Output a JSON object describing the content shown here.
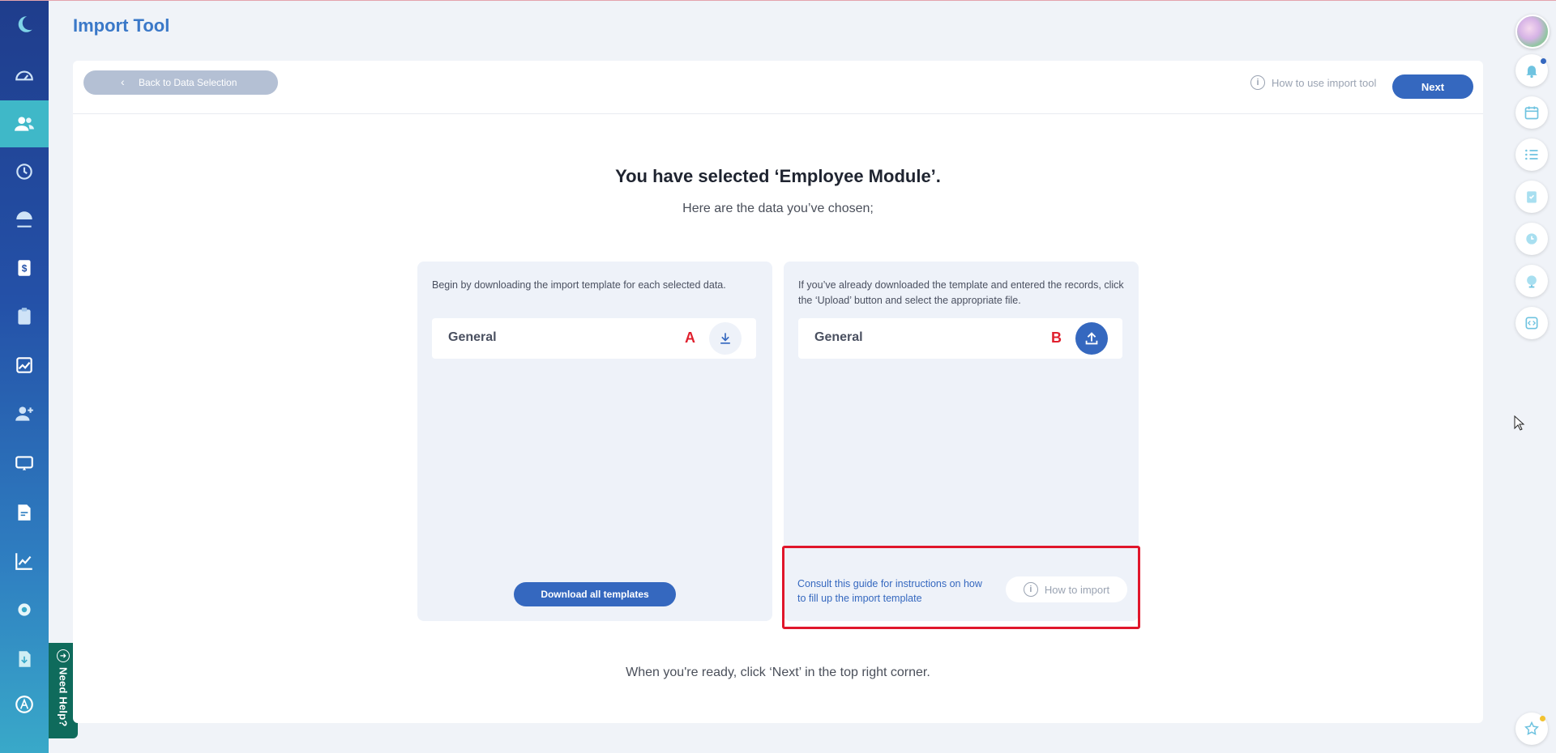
{
  "sidebar": {
    "items": [
      {
        "icon": "moon-logo-icon",
        "active": false
      },
      {
        "icon": "dashboard-gauge-icon",
        "active": false
      },
      {
        "icon": "employees-icon",
        "active": true
      },
      {
        "icon": "history-clock-icon",
        "active": false
      },
      {
        "icon": "leave-umbrella-icon",
        "active": false
      },
      {
        "icon": "payroll-dollar-icon",
        "active": false
      },
      {
        "icon": "clipboard-icon",
        "active": false
      },
      {
        "icon": "image-chart-icon",
        "active": false
      },
      {
        "icon": "add-user-icon",
        "active": false
      },
      {
        "icon": "training-screen-icon",
        "active": false
      },
      {
        "icon": "document-icon",
        "active": false
      },
      {
        "icon": "analytics-line-icon",
        "active": false
      },
      {
        "icon": "settings-gear-icon",
        "active": false
      },
      {
        "icon": "file-download-icon",
        "active": false
      },
      {
        "icon": "app-store-icon",
        "active": false
      }
    ],
    "need_help_label": "Need Help?"
  },
  "header": {
    "title": "Import Tool"
  },
  "toolbar": {
    "back_label": "Back to Data Selection",
    "how_to_use_label": "How to use import tool",
    "next_label": "Next"
  },
  "main": {
    "heading": "You have selected ‘Employee Module’.",
    "subheading": "Here are the data you’ve chosen;",
    "download_panel": {
      "instruction": "Begin by downloading the import template for each selected data.",
      "items": [
        {
          "name": "General",
          "marker": "A"
        }
      ],
      "download_all_label": "Download all templates"
    },
    "upload_panel": {
      "instruction": "If you’ve already downloaded the template and entered the records, click the ‘Upload’ button and select the appropriate file.",
      "items": [
        {
          "name": "General",
          "marker": "B"
        }
      ],
      "guide_text": "Consult this guide for instructions on how to fill up the import template",
      "how_to_import_label": "How to import"
    },
    "footer": "When you're ready, click ‘Next’ in the top right corner."
  },
  "colors": {
    "accent": "#3568bf",
    "title": "#3a78c8",
    "highlight_border": "#e0162b",
    "marker": "#e0202e",
    "need_help_bg": "#0f6b5c",
    "sidebar_active": "#3fb8c8"
  },
  "right_rail": [
    "avatar",
    "notification-bell-icon",
    "calendar-icon",
    "list-icon",
    "checklist-icon",
    "clock-icon",
    "globe-icon",
    "code-embed-icon",
    "favorite-star-icon"
  ]
}
